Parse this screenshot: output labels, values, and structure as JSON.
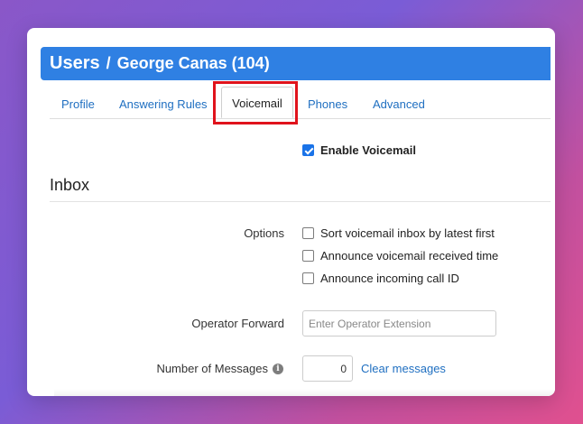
{
  "breadcrumb": {
    "root": "Users",
    "separator": "/",
    "current": "George Canas (104)"
  },
  "tabs": [
    {
      "label": "Profile",
      "active": false
    },
    {
      "label": "Answering Rules",
      "active": false
    },
    {
      "label": "Voicemail",
      "active": true
    },
    {
      "label": "Phones",
      "active": false
    },
    {
      "label": "Advanced",
      "active": false
    }
  ],
  "enable_voicemail": {
    "label": "Enable Voicemail",
    "checked": true
  },
  "inbox": {
    "title": "Inbox",
    "options_label": "Options",
    "options": [
      {
        "label": "Sort voicemail inbox by latest first",
        "checked": false
      },
      {
        "label": "Announce voicemail received time",
        "checked": false
      },
      {
        "label": "Announce incoming call ID",
        "checked": false
      }
    ],
    "operator_forward": {
      "label": "Operator Forward",
      "placeholder": "Enter Operator Extension",
      "value": ""
    },
    "number_of_messages": {
      "label": "Number of Messages",
      "value": "0",
      "clear_link": "Clear messages"
    }
  },
  "colors": {
    "header": "#2f80e3",
    "link": "#1f6fc1",
    "highlight": "#e0131c",
    "checkbox": "#1a73e8"
  },
  "icons": {
    "info": "info-circle-icon",
    "check": "checkmark-icon"
  }
}
